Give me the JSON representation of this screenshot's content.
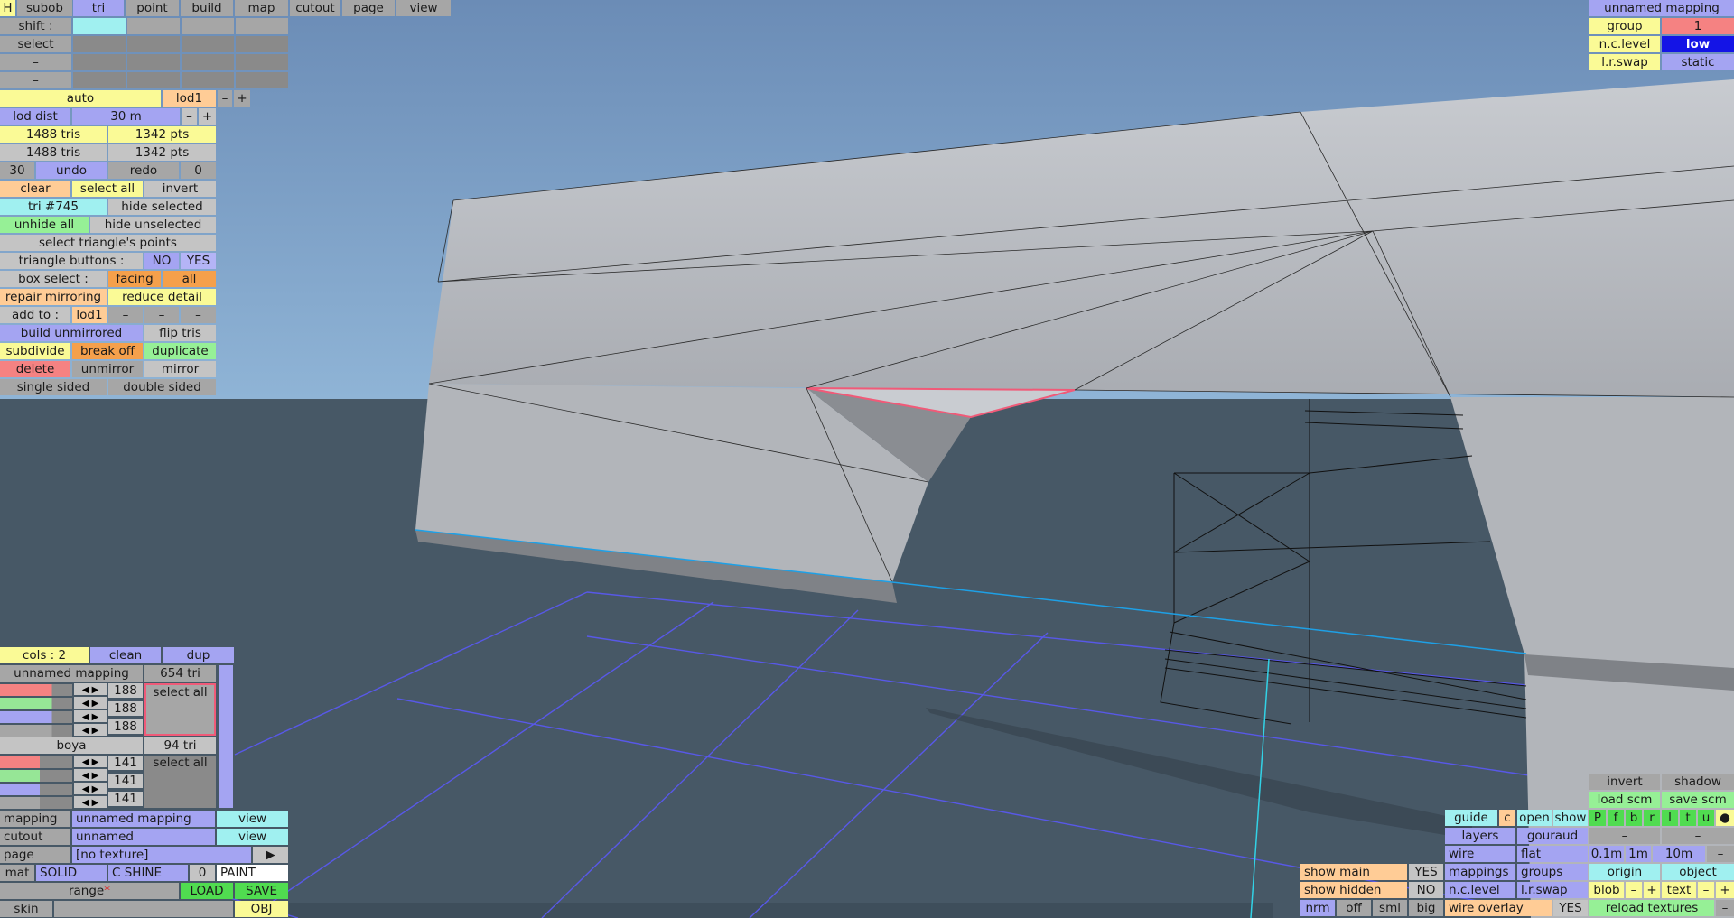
{
  "toolbar": {
    "h": "H",
    "tabs": [
      "subob",
      "tri",
      "point",
      "build",
      "map",
      "cutout",
      "page",
      "view"
    ]
  },
  "shift_label": "shift :",
  "select_label": "select",
  "dash": "–",
  "lod": {
    "auto": "auto",
    "lod": "lod1",
    "minus": "–",
    "plus": "+",
    "dist_label": "lod dist",
    "dist_value": "30 m"
  },
  "stats": {
    "tris1": "1488 tris",
    "pts1": "1342 pts",
    "tris2": "1488 tris",
    "pts2": "1342 pts"
  },
  "undo": {
    "count": "30",
    "undo": "undo",
    "redo": "redo",
    "redo_count": "0"
  },
  "sel": {
    "clear": "clear",
    "select_all": "select all",
    "invert": "invert",
    "tri_id": "tri #745",
    "hide_selected": "hide selected",
    "unhide_all": "unhide all",
    "hide_unselected": "hide unselected",
    "select_points": "select triangle's points"
  },
  "tri_buttons": {
    "label": "triangle buttons :",
    "no": "NO",
    "yes": "YES"
  },
  "box_select": {
    "label": "box select :",
    "facing": "facing",
    "all": "all"
  },
  "repair": "repair mirroring",
  "reduce": "reduce detail",
  "add_to": {
    "label": "add to :",
    "lod": "lod1"
  },
  "ops": {
    "build_unmirrored": "build unmirrored",
    "flip_tris": "flip tris",
    "subdivide": "subdivide",
    "break_off": "break off",
    "duplicate": "duplicate",
    "delete": "delete",
    "unmirror": "unmirror",
    "mirror": "mirror",
    "single_sided": "single sided",
    "double_sided": "double sided"
  },
  "top_right": {
    "mapping": "unnamed mapping",
    "group_label": "group",
    "group_value": "1",
    "nclevel_label": "n.c.level",
    "nclevel_value": "low",
    "lrswap_label": "l.r.swap",
    "lrswap_value": "static"
  },
  "mat_panel": {
    "cols": "cols : 2",
    "clean": "clean",
    "dup": "dup",
    "m1_name": "unnamed mapping",
    "m1_tris": "654 tri",
    "m1_vals": [
      "188",
      "188",
      "188"
    ],
    "m1_select": "select all",
    "m2_name": "boya",
    "m2_tris": "94 tri",
    "m2_vals": [
      "141",
      "141",
      "141"
    ],
    "m2_select": "select all",
    "m1_fill": [
      0.72,
      0.72,
      0.72,
      0.72
    ],
    "m2_fill": [
      0.55,
      0.55,
      0.55,
      0.55
    ],
    "bar_colors": [
      "#f58282",
      "#96e696",
      "#a4a4f2",
      "#a6a6a6"
    ]
  },
  "bottom_left": {
    "mapping_label": "mapping",
    "mapping_value": "unnamed mapping",
    "view": "view",
    "cutout_label": "cutout",
    "cutout_value": "unnamed",
    "page_label": "page",
    "page_value": "[no texture]",
    "page_arrow": "▶",
    "mat": "mat",
    "solid": "SOLID",
    "cshine": "C SHINE",
    "zero": "0",
    "paint": "PAINT",
    "range": "range",
    "range_star": "*",
    "load": "LOAD",
    "save": "SAVE",
    "skin": "skin",
    "obj": "OBJ"
  },
  "bottom_right": {
    "invert": "invert",
    "shadow": "shadow",
    "load_scm": "load scm",
    "save_scm": "save scm",
    "guide": "guide",
    "c": "c",
    "open": "open",
    "show": "show",
    "letters": [
      "P",
      "f",
      "b",
      "r",
      "l",
      "t",
      "u",
      "●"
    ],
    "layers": "layers",
    "gouraud": "gouraud",
    "wire": "wire",
    "flat": "flat",
    "s01": "0.1m",
    "s1": "1m",
    "s10": "10m",
    "show_main": "show main",
    "yes": "YES",
    "mappings": "mappings",
    "groups": "groups",
    "origin": "origin",
    "object": "object",
    "show_hidden": "show hidden",
    "no": "NO",
    "nclevel": "n.c.level",
    "lrswap": "l.r.swap",
    "blob": "blob",
    "plus": "+",
    "text": "text",
    "nrm": "nrm",
    "off": "off",
    "sml": "sml",
    "big": "big",
    "wire_overlay": "wire overlay",
    "reload": "reload textures"
  },
  "colors": {
    "sky_top": "#6b8cb6",
    "sky_bottom": "#8fb4d6",
    "ground": "#475866",
    "grid": "#5858e8",
    "highlight": "#f05a78",
    "cyan": "#1ea0e6"
  }
}
